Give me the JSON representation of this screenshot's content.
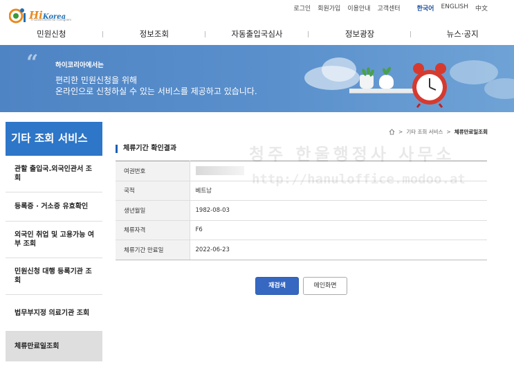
{
  "header": {
    "logo_text": "Hi",
    "logo_suffix": "Korea",
    "logo_sub": "e-Government for Foreigners",
    "util_links": [
      "로그인",
      "회원가입",
      "이용안내",
      "고객센터"
    ],
    "languages": [
      "한국어",
      "ENGLISH",
      "中文"
    ],
    "active_language": "한국어",
    "nav": [
      "민원신청",
      "정보조회",
      "자동출입국심사",
      "정보광장",
      "뉴스·공지"
    ]
  },
  "banner": {
    "small": "하이코리아에서는",
    "line1": "편리한 민원신청을 위해",
    "line2": "온라인으로 신청하실 수 있는 서비스를 제공하고 있습니다."
  },
  "sidebar": {
    "title": "기타 조회 서비스",
    "items": [
      {
        "label": "관할 출입국.외국인관서 조회"
      },
      {
        "label": "등록증 · 거소증 유효확인"
      },
      {
        "label": "외국인 취업 및 고용가능 여부 조회"
      },
      {
        "label": "민원신청 대행 등록기관 조회"
      },
      {
        "label": "법무부지정 의료기관 조회"
      },
      {
        "label": "체류만료일조회"
      }
    ],
    "active_index": 5
  },
  "breadcrumb": {
    "items": [
      "기타 조회 서비스",
      "체류만료일조회"
    ],
    "separator": ">"
  },
  "section_title": "체류기간 확인결과",
  "watermark": {
    "line1": "청주 한울행정사 사무소",
    "line2": "http://hanuloffice.modoo.at"
  },
  "result_table": [
    {
      "label": "여권번호",
      "value": ""
    },
    {
      "label": "국적",
      "value": "베트남"
    },
    {
      "label": "생년월일",
      "value": "1982-08-03"
    },
    {
      "label": "체류자격",
      "value": "F6"
    },
    {
      "label": "체류기간 만료일",
      "value": "2022-06-23"
    }
  ],
  "buttons": {
    "search_again": "재검색",
    "main_screen": "메인화면"
  },
  "colors": {
    "brand_blue": "#2d76c8",
    "banner_blue": "#5a90cc",
    "primary_button": "#3668c2"
  }
}
